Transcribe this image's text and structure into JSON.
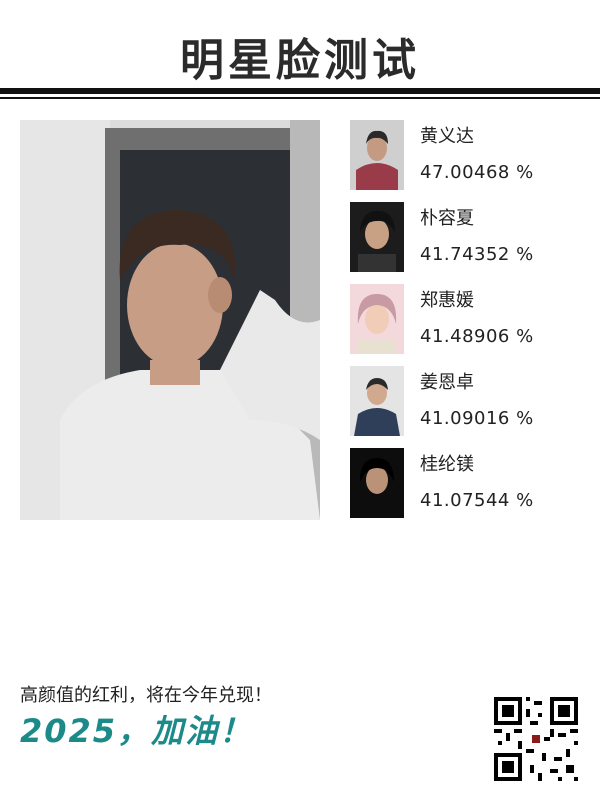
{
  "header": {
    "title": "明星脸测试"
  },
  "results": [
    {
      "name": "黄义达",
      "score": "47.00468 %",
      "icon": "celebrity-photo-1"
    },
    {
      "name": "朴容夏",
      "score": "41.74352 %",
      "icon": "celebrity-photo-2"
    },
    {
      "name": "郑惠媛",
      "score": "41.48906 %",
      "icon": "celebrity-photo-3"
    },
    {
      "name": "姜恩卓",
      "score": "41.09016 %",
      "icon": "celebrity-photo-4"
    },
    {
      "name": "桂纶镁",
      "score": "41.07544 %",
      "icon": "celebrity-photo-5"
    }
  ],
  "footer": {
    "tagline": "高颜值的红利，将在今年兑现！",
    "slogan": "2025，加油！",
    "qr_icon": "qr-code-icon"
  },
  "colors": {
    "accent": "#1d8a8a",
    "rule": "#111111"
  }
}
